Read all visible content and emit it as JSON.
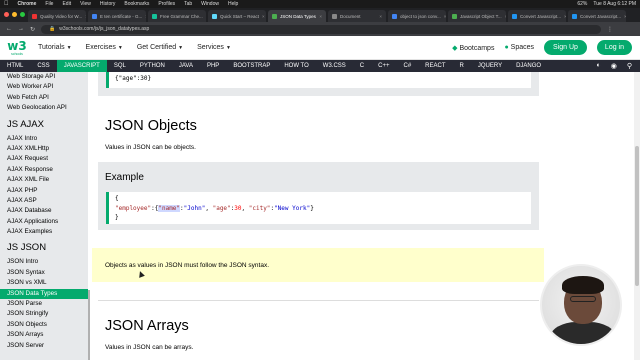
{
  "menubar": {
    "app": "Chrome",
    "items": [
      "File",
      "Edit",
      "View",
      "History",
      "Bookmarks",
      "Profiles",
      "Tab",
      "Window",
      "Help"
    ],
    "battery": "62%",
    "datetime": "Tue 8 Aug 6:12 PM"
  },
  "tabs": [
    {
      "label": "Quality Video for W..."
    },
    {
      "label": "E ten certificate - G..."
    },
    {
      "label": "Free Grammar Che..."
    },
    {
      "label": "Quick Start – React"
    },
    {
      "label": "JSON Data Types",
      "active": true
    },
    {
      "label": "Document"
    },
    {
      "label": "object to json conv..."
    },
    {
      "label": "Javascript Object T..."
    },
    {
      "label": "Convert Javascript..."
    },
    {
      "label": "Convert Javascript..."
    }
  ],
  "address": {
    "url": "w3schools.com/js/js_json_datatypes.asp"
  },
  "header": {
    "logo_text": "w3",
    "logo_sub": "schools",
    "menu": [
      "Tutorials",
      "Exercises",
      "Get Certified",
      "Services"
    ],
    "bootcamps": "Bootcamps",
    "spaces": "Spaces",
    "signup": "Sign Up",
    "login": "Log in"
  },
  "topnav": [
    "HTML",
    "CSS",
    "JAVASCRIPT",
    "SQL",
    "PYTHON",
    "JAVA",
    "PHP",
    "BOOTSTRAP",
    "HOW TO",
    "W3.CSS",
    "C",
    "C++",
    "C#",
    "REACT",
    "R",
    "JQUERY",
    "DJANGO"
  ],
  "topnav_active": "JAVASCRIPT",
  "sidebar": {
    "group1": [
      "Web Storage API",
      "Web Worker API",
      "Web Fetch API",
      "Web Geolocation API"
    ],
    "heading_ajax": "JS AJAX",
    "ajax": [
      "AJAX Intro",
      "AJAX XMLHttp",
      "AJAX Request",
      "AJAX Response",
      "AJAX XML File",
      "AJAX PHP",
      "AJAX ASP",
      "AJAX Database",
      "AJAX Applications",
      "AJAX Examples"
    ],
    "heading_json": "JS JSON",
    "json": [
      "JSON Intro",
      "JSON Syntax",
      "JSON vs XML",
      "JSON Data Types",
      "JSON Parse",
      "JSON Stringify",
      "JSON Objects",
      "JSON Arrays",
      "JSON Server"
    ],
    "active_item": "JSON Data Types"
  },
  "content": {
    "top_code": "{\"age\":30}",
    "h_objects": "JSON Objects",
    "p_objects": "Values in JSON can be objects.",
    "example_title": "Example",
    "example_line1": "{",
    "example_line2": {
      "k1": "\"employee\"",
      "colon1": ":{",
      "k2": "\"name\"",
      "colon2": ":",
      "v2": "\"John\"",
      "comma2": ", ",
      "k3": "\"age\"",
      "colon3": ":",
      "v3": "30",
      "comma3": ", ",
      "k4": "\"city\"",
      "colon4": ":",
      "v4": "\"New York\"",
      "close": "}"
    },
    "example_line3": "}",
    "note": "Objects as values in JSON must follow the JSON syntax.",
    "h_arrays": "JSON Arrays",
    "p_arrays": "Values in JSON can be arrays."
  },
  "colors": {
    "brand": "#04AA6D",
    "topnav_bg": "#282A35",
    "sidebar_bg": "#E7E9EB",
    "note_bg": "#FFFFCC"
  }
}
